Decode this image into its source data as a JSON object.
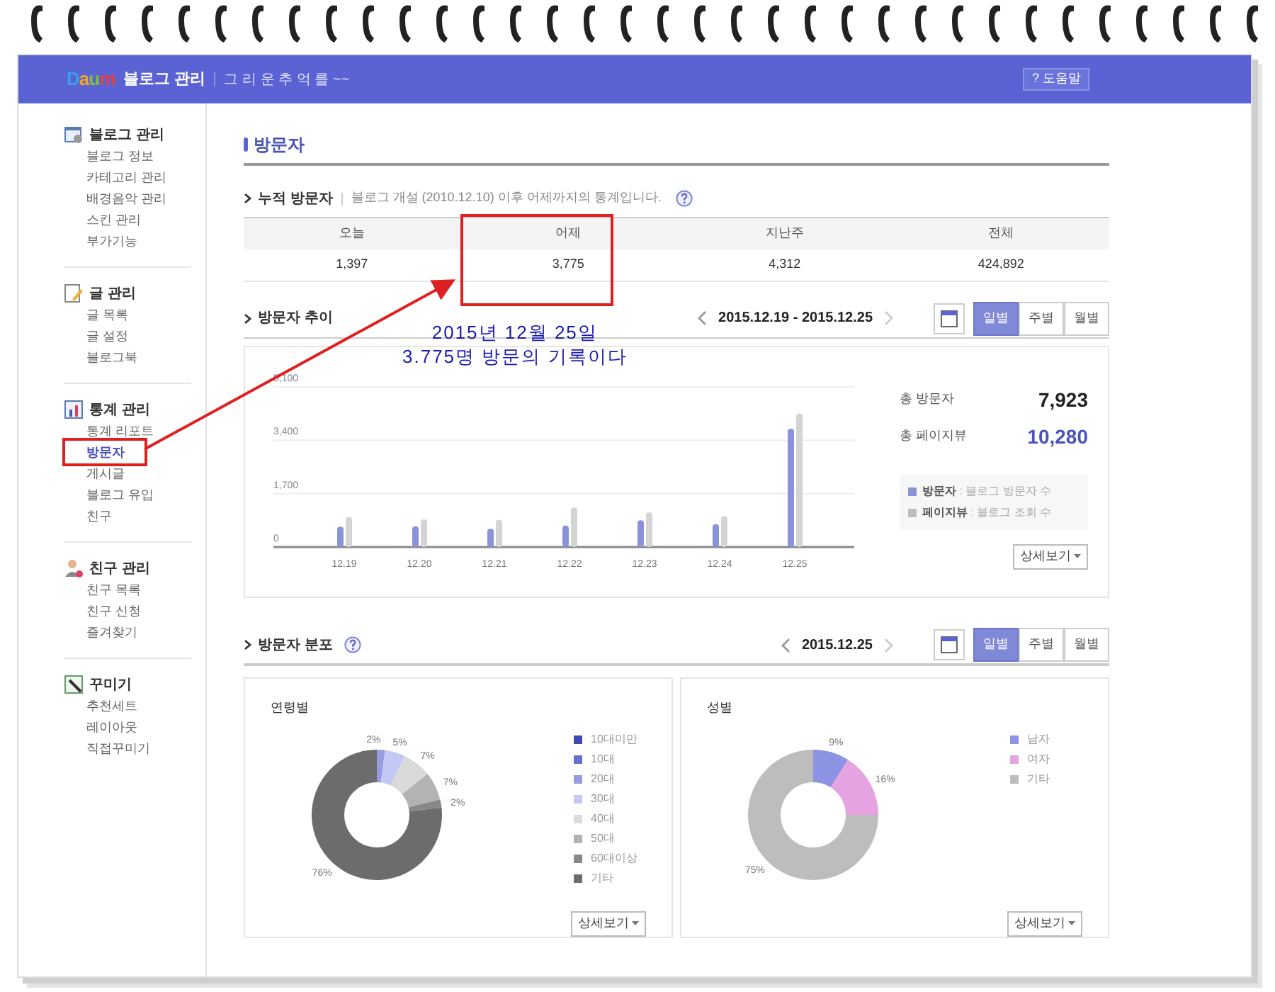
{
  "header": {
    "logo": "Daum",
    "title": "블로그 관리",
    "subtitle": "그 리 운 추 억 를 ~~",
    "help": "? 도움말"
  },
  "sidebar": [
    {
      "title": "블로그 관리",
      "kind": "window",
      "items": [
        {
          "label": "블로그 정보",
          "selected": false
        },
        {
          "label": "카테고리 관리",
          "selected": false
        },
        {
          "label": "배경음악 관리",
          "selected": false
        },
        {
          "label": "스킨 관리",
          "selected": false
        },
        {
          "label": "부가기능",
          "selected": false
        }
      ]
    },
    {
      "title": "글 관리",
      "kind": "pencil",
      "items": [
        {
          "label": "글 목록",
          "selected": false
        },
        {
          "label": "글 설정",
          "selected": false
        },
        {
          "label": "블로그북",
          "selected": false
        }
      ]
    },
    {
      "title": "통계 관리",
      "kind": "stats",
      "items": [
        {
          "label": "통계 리포트",
          "selected": false
        },
        {
          "label": "방문자",
          "selected": true
        },
        {
          "label": "게시글",
          "selected": false
        },
        {
          "label": "블로그 유입",
          "selected": false
        },
        {
          "label": "친구",
          "selected": false
        }
      ]
    },
    {
      "title": "친구 관리",
      "kind": "person",
      "items": [
        {
          "label": "친구 목록",
          "selected": false
        },
        {
          "label": "친구 신청",
          "selected": false
        },
        {
          "label": "즐겨찾기",
          "selected": false
        }
      ]
    },
    {
      "title": "꾸미기",
      "kind": "brush",
      "items": [
        {
          "label": "추천세트",
          "selected": false
        },
        {
          "label": "레이아웃",
          "selected": false
        },
        {
          "label": "직접꾸미기",
          "selected": false
        }
      ]
    }
  ],
  "page_title": "방문자",
  "cumulative": {
    "heading": "누적 방문자",
    "note": "블로그 개설 (2010.12.10) 이후 어제까지의 통계입니다.",
    "columns": [
      "오늘",
      "어제",
      "지난주",
      "전체"
    ],
    "values": [
      "1,397",
      "3,775",
      "4,312",
      "424,892"
    ]
  },
  "trend": {
    "heading": "방문자 추이",
    "date_range": "2015.12.19 - 2015.12.25",
    "tabs": [
      {
        "label": "일별",
        "selected": true
      },
      {
        "label": "주별",
        "selected": false
      },
      {
        "label": "월별",
        "selected": false
      }
    ],
    "chart_data": {
      "type": "bar",
      "categories": [
        "12.19",
        "12.20",
        "12.21",
        "12.22",
        "12.23",
        "12.24",
        "12.25"
      ],
      "ylim": [
        0,
        5100
      ],
      "yticks": [
        {
          "value": 0,
          "label": "0"
        },
        {
          "value": 1700,
          "label": "1,700"
        },
        {
          "value": 3400,
          "label": "3,400"
        },
        {
          "value": 5100,
          "label": "5,100"
        }
      ],
      "series": [
        {
          "name": "방문자",
          "color": "#8a92d8",
          "values": [
            650,
            660,
            580,
            680,
            850,
            730,
            3770
          ]
        },
        {
          "name": "페이지뷰",
          "color": "#d4d4d4",
          "values": [
            950,
            880,
            870,
            1250,
            1100,
            980,
            4250
          ]
        }
      ]
    },
    "totals": [
      {
        "label": "총 방문자",
        "value": "7,923",
        "color": "#222222"
      },
      {
        "label": "총 페이지뷰",
        "value": "10,280",
        "color": "#4b54b8"
      }
    ],
    "legend": [
      {
        "desc": ": 블로그 방문자 수",
        "color": "#8a92d8"
      },
      {
        "desc": ": 블로그 조회 수",
        "color": "#bdbdbd"
      }
    ],
    "detail_button": "상세보기"
  },
  "distribution": {
    "heading": "방문자 분포",
    "date": "2015.12.25",
    "tabs": [
      {
        "label": "일별",
        "selected": true
      },
      {
        "label": "주별",
        "selected": false
      },
      {
        "label": "월별",
        "selected": false
      }
    ],
    "panels": [
      {
        "legend": [
          {
            "color": "#3f4bb5"
          },
          {
            "color": "#6670c8"
          },
          {
            "color": "#959ce0"
          },
          {
            "color": "#c3c8f4"
          },
          {
            "color": "#dadada"
          },
          {
            "color": "#b3b3b3"
          },
          {
            "color": "#888888"
          },
          {
            "color": "#6c6c6c"
          }
        ],
        "chart_data": {
          "type": "donut",
          "categories": [
            "10대미만",
            "10대",
            "20대",
            "30대",
            "40대",
            "50대",
            "60대이상",
            "기타"
          ],
          "series": [
            {
              "name": "연령별",
              "values": [
                0,
                0,
                2,
                5,
                7,
                7,
                2,
                76
              ]
            }
          ],
          "value_labels": [
            null,
            null,
            "2%",
            "5%",
            "7%",
            "7%",
            "2%",
            "76%"
          ]
        },
        "detail_button": "상세보기"
      },
      {
        "legend": [
          {
            "color": "#8b93e2"
          },
          {
            "color": "#e6a3e2"
          },
          {
            "color": "#bdbdbd"
          }
        ],
        "chart_data": {
          "type": "donut",
          "categories": [
            "남자",
            "여자",
            "기타"
          ],
          "series": [
            {
              "name": "성별",
              "values": [
                9,
                16,
                75
              ]
            }
          ],
          "value_labels": [
            "9%",
            "16%",
            "75%"
          ]
        },
        "detail_button": "상세보기"
      }
    ]
  },
  "annotation": {
    "lines": [
      "2015년 12월 25일",
      "3.775명 방문의 기록이다"
    ]
  }
}
